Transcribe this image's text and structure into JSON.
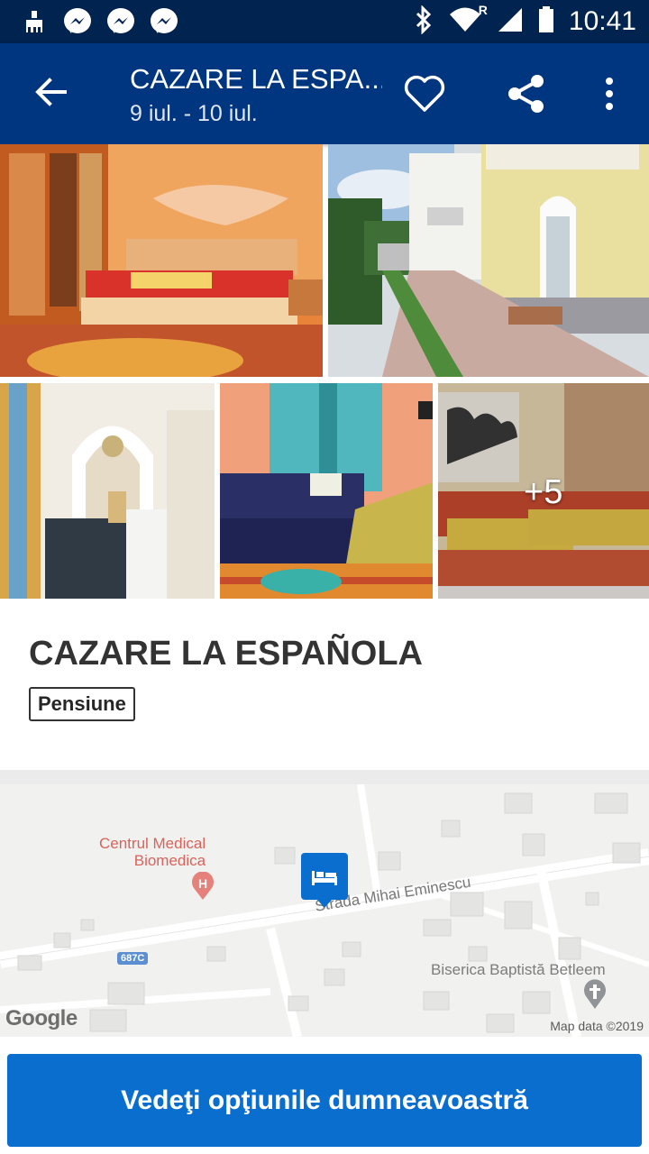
{
  "status_bar": {
    "time": "10:41",
    "left_icons": [
      "cleaner-icon",
      "messenger-icon",
      "messenger-icon",
      "messenger-icon"
    ],
    "right_icons": [
      "bluetooth-icon",
      "wifi-icon",
      "signal-icon",
      "battery-icon"
    ],
    "signal_roaming_label": "R"
  },
  "app_bar": {
    "title": "CAZARE LA ESPA...",
    "dates": "9 iul. - 10 iul.",
    "colors": {
      "background": "#003580",
      "status_bar": "#00234f"
    }
  },
  "photos": {
    "more_count": "+5",
    "items": [
      "bedroom-orange",
      "exterior-street",
      "hallway-arch",
      "bedroom-blue-curtains",
      "bedroom-twin-beds"
    ]
  },
  "hotel": {
    "name": "CAZARE LA ESPAÑOLA",
    "type": "Pensiune"
  },
  "map": {
    "poi_medical": "Centrul Medical\nBiomedica",
    "poi_church": "Biserica Baptistă Betleem",
    "street": "Strada Mihai Eminescu",
    "route": "687C",
    "google_logo": "Google",
    "attribution": "Map data ©2019",
    "colors": {
      "marker": "#0a6ece",
      "medical": "#d9625b",
      "church": "#8a8a8a"
    }
  },
  "cta": {
    "label": "Vedeţi opţiunile dumneavoastră",
    "color": "#0a6ece"
  }
}
